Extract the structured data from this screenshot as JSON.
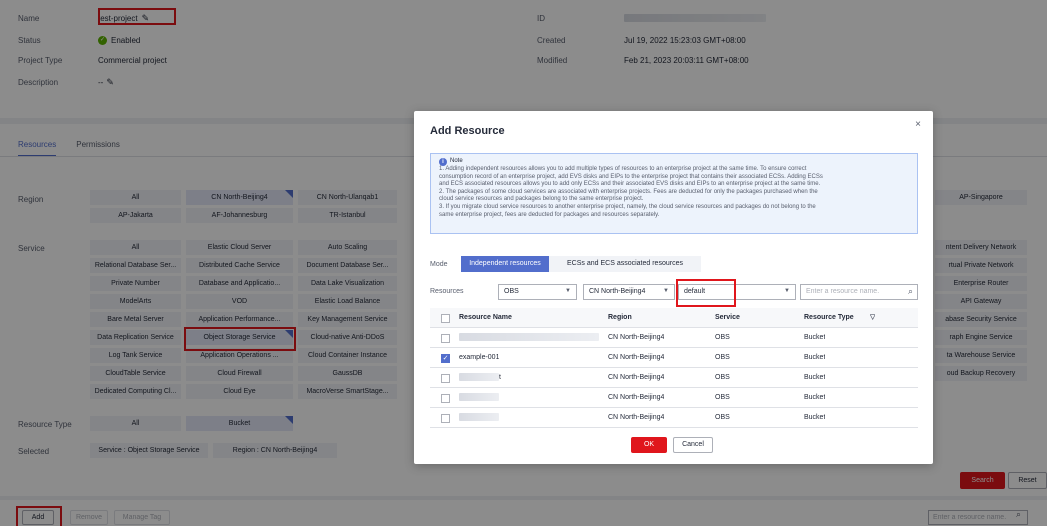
{
  "details": {
    "name_label": "Name",
    "name_value": "test-project",
    "status_label": "Status",
    "status_value": "Enabled",
    "type_label": "Project Type",
    "type_value": "Commercial project",
    "desc_label": "Description",
    "desc_value": "--",
    "id_label": "ID",
    "created_label": "Created",
    "created_value": "Jul 19, 2022 15:23:03 GMT+08:00",
    "modified_label": "Modified",
    "modified_value": "Feb 21, 2023 20:03:11 GMT+08:00"
  },
  "tabs": [
    "Resources",
    "Permissions"
  ],
  "filters": {
    "region_label": "Region",
    "regions_left": [
      "All",
      "CN North-Beijing4",
      "CN North-Ulanqab1",
      "AP-Jakarta",
      "AF-Johannesburg",
      "TR-Istanbul"
    ],
    "regions_right": [
      "AP-Singapore"
    ],
    "service_label": "Service",
    "services": [
      [
        "All",
        "Elastic Cloud Server",
        "Auto Scaling"
      ],
      [
        "Relational Database Ser...",
        "Distributed Cache Service",
        "Document Database Ser..."
      ],
      [
        "Private Number",
        "Database and Applicatio...",
        "Data Lake Visualization"
      ],
      [
        "ModelArts",
        "VOD",
        "Elastic Load Balance"
      ],
      [
        "Bare Metal Server",
        "Application Performance...",
        "Key Management Service"
      ],
      [
        "Data Replication Service",
        "Object Storage Service",
        "Cloud-native Anti-DDoS"
      ],
      [
        "Log Tank Service",
        "Application Operations ...",
        "Cloud Container Instance"
      ],
      [
        "CloudTable Service",
        "Cloud Firewall",
        "GaussDB"
      ],
      [
        "Dedicated Computing Cl...",
        "Cloud Eye",
        "MacroVerse SmartStage..."
      ]
    ],
    "services_right": [
      "ntent Delivery Network",
      "rtual Private Network",
      "Enterprise Router",
      "API Gateway",
      "abase Security Service",
      "raph Engine Service",
      "ta Warehouse Service",
      "oud Backup Recovery"
    ],
    "resource_type_label": "Resource Type",
    "resource_types": [
      "All",
      "Bucket"
    ],
    "selected_label": "Selected",
    "selected_tags": [
      "Service : Object Storage Service",
      "Region : CN North-Beijing4"
    ]
  },
  "actions": {
    "search": "Search",
    "reset": "Reset",
    "add": "Add",
    "remove": "Remove",
    "manage_tag": "Manage Tag",
    "search_placeholder": "Enter a resource name."
  },
  "dialog": {
    "title": "Add Resource",
    "close": "×",
    "note_title": "Note",
    "note_lines": [
      "1. Adding independent resources allows you to add multiple types of resources to an enterprise project at the same time. To ensure correct",
      "consumption record of an enterprise project, add EVS disks and EIPs to the enterprise project that contains their associated ECSs. Adding ECSs",
      "and ECS associated resources allows you to add only ECSs and their associated EVS disks and EIPs to an enterprise project at the same time.",
      "2. The packages of some cloud services are associated with enterprise projects. Fees are deducted for only the packages purchased when the",
      "cloud service resources and packages belong to the same enterprise project.",
      "3. If you migrate cloud service resources to another enterprise project, namely, the cloud service resources and packages do not belong to the",
      "same enterprise project, fees are deducted for packages and resources separately."
    ],
    "mode_label": "Mode",
    "mode_independent": "Independent resources",
    "mode_ecs": "ECSs and ECS associated resources",
    "resources_label": "Resources",
    "service_select": "OBS",
    "region_select": "CN North-Beijing4",
    "project_select": "default",
    "search_placeholder": "Enter a resource name.",
    "columns": [
      "Resource Name",
      "Region",
      "Service",
      "Resource Type"
    ],
    "rows": [
      {
        "name": "",
        "region": "CN North-Beijing4",
        "service": "OBS",
        "type": "Bucket",
        "checked": false
      },
      {
        "name": "example-001",
        "region": "CN North-Beijing4",
        "service": "OBS",
        "type": "Bucket",
        "checked": true
      },
      {
        "name": "t",
        "region": "CN North-Beijing4",
        "service": "OBS",
        "type": "Bucket",
        "checked": false
      },
      {
        "name": "",
        "region": "CN North-Beijing4",
        "service": "OBS",
        "type": "Bucket",
        "checked": false
      },
      {
        "name": "",
        "region": "CN North-Beijing4",
        "service": "OBS",
        "type": "Bucket",
        "checked": false
      }
    ],
    "ok": "OK",
    "cancel": "Cancel"
  }
}
